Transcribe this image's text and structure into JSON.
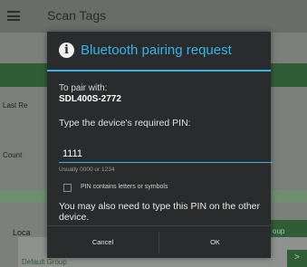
{
  "app": {
    "title": "Scan Tags",
    "last_read_label": "Last Re",
    "count_label": "Count",
    "local_label": "Loca",
    "group_button_label": "oup",
    "default_group_text": "Default Group",
    "chevron": ">"
  },
  "dialog": {
    "icon_letter": "i",
    "title": "Bluetooth pairing request",
    "pair_with_label": "To pair with:",
    "device_name": "SDL400S-2772",
    "pin_prompt": "Type the device's required PIN:",
    "pin_value": "1111",
    "hint": "Usually 0000 or 1234",
    "checkbox_label": "PIN contains letters or symbols",
    "checkbox_checked": false,
    "note": "You may also need to type this PIN on the other device.",
    "cancel_label": "Cancel",
    "ok_label": "OK"
  },
  "colors": {
    "accent": "#33b5e5",
    "dialog_bg": "#2a2b2c",
    "app_green": "#2f5e36"
  },
  "icons": {
    "menu": "hamburger-icon",
    "info": "info-icon",
    "chevron": "chevron-right-icon"
  }
}
